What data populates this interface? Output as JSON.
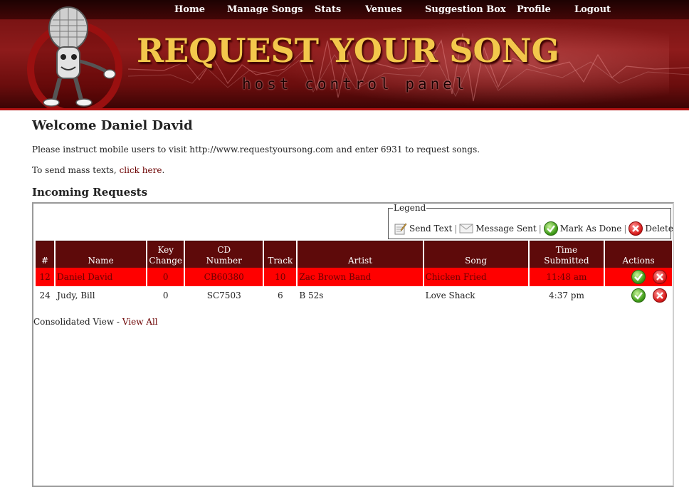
{
  "nav": {
    "items": [
      "Home",
      "Manage Songs",
      "Stats",
      "Venues",
      "Suggestion Box",
      "Profile",
      "Logout"
    ]
  },
  "brand": {
    "title": "REQUEST YOUR SONG",
    "subtitle": "host control panel"
  },
  "welcome": "Welcome Daniel David",
  "instructions": "Please instruct mobile users to visit http://www.requestyoursong.com and enter 6931 to request songs.",
  "mass_text": {
    "prefix": "To send mass texts, ",
    "link": "click here",
    "suffix": "."
  },
  "incoming_title": "Incoming Requests",
  "legend": {
    "title": "Legend",
    "items": [
      {
        "icon": "send-text-icon",
        "label": "Send Text"
      },
      {
        "icon": "message-sent-icon",
        "label": "Message Sent"
      },
      {
        "icon": "mark-done-icon",
        "label": "Mark As Done"
      },
      {
        "icon": "delete-icon",
        "label": "Delete"
      }
    ],
    "separator": "|"
  },
  "table": {
    "headers": {
      "num": "#",
      "name": "Name",
      "key1": "Key",
      "key2": "Change",
      "cd1": "CD",
      "cd2": "Number",
      "track": "Track",
      "artist": "Artist",
      "song": "Song",
      "time1": "Time",
      "time2": "Submitted",
      "actions": "Actions"
    },
    "rows": [
      {
        "num": "12",
        "name": "Daniel David",
        "key": "0",
        "cd": "CB60380",
        "track": "10",
        "artist": "Zac Brown Band",
        "song": "Chicken Fried",
        "time": "11:48 am",
        "highlighted": true
      },
      {
        "num": "24",
        "name": "Judy, Bill",
        "key": "0",
        "cd": "SC7503",
        "track": "6",
        "artist": "B 52s",
        "song": "Love Shack",
        "time": "4:37 pm",
        "highlighted": false
      }
    ]
  },
  "footer": {
    "consolidated": "Consolidated View - ",
    "view_all": "View All"
  },
  "colors": {
    "header_bg": "#7a1414",
    "table_header": "#5e0a0a",
    "highlight_row": "#ff0000",
    "brand_gold": "#f3c84c"
  }
}
